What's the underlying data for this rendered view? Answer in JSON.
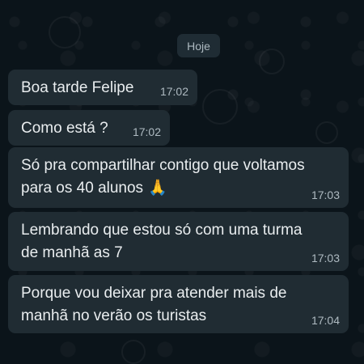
{
  "chat": {
    "date_chip": "Hoje",
    "messages": [
      {
        "text": "Boa tarde Felipe",
        "time": "17:02"
      },
      {
        "text": "Como está ?",
        "time": "17:02"
      },
      {
        "text": "Só pra compartilhar contigo que voltamos\npara os 40 alunos",
        "emoji": "🙏",
        "time": "17:03"
      },
      {
        "text": "Lembrando que estou só com uma turma\nde manhã as 7",
        "time": "17:03"
      },
      {
        "text": "Porque vou deixar pra atender mais de\nmanhã no verão os turistas",
        "time": "17:04"
      }
    ]
  },
  "colors": {
    "background": "#0b141a",
    "bubble": "#202c33",
    "text": "#e9edef",
    "time": "#aebac1"
  }
}
